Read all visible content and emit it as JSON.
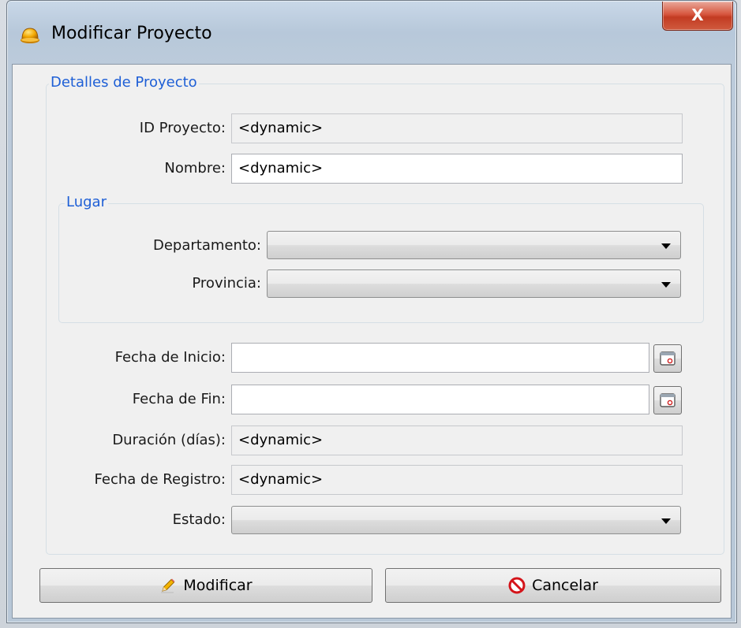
{
  "window": {
    "title": "Modificar Proyecto",
    "close_glyph": "X"
  },
  "details_group": {
    "title": "Detalles de Proyecto",
    "id_label": "ID Proyecto:",
    "id_value": "<dynamic>",
    "nombre_label": "Nombre:",
    "nombre_value": "<dynamic>"
  },
  "lugar_group": {
    "title": "Lugar",
    "departamento_label": "Departamento:",
    "departamento_value": "",
    "provincia_label": "Provincia:",
    "provincia_value": ""
  },
  "dates": {
    "inicio_label": "Fecha de Inicio:",
    "inicio_value": "",
    "fin_label": "Fecha de Fin:",
    "fin_value": "",
    "duracion_label": "Duración (días):",
    "duracion_value": "<dynamic>",
    "registro_label": "Fecha de Registro:",
    "registro_value": "<dynamic>",
    "estado_label": "Estado:",
    "estado_value": ""
  },
  "buttons": {
    "modificar_label": "Modificar",
    "cancelar_label": "Cancelar"
  },
  "icons": {
    "app": "hardhat-icon",
    "close": "close-icon",
    "calendar": "calendar-icon",
    "pencil": "pencil-icon",
    "cancel": "cancel-icon"
  },
  "colors": {
    "group_title": "#1e5fd6",
    "close_button": "#c8432a"
  }
}
